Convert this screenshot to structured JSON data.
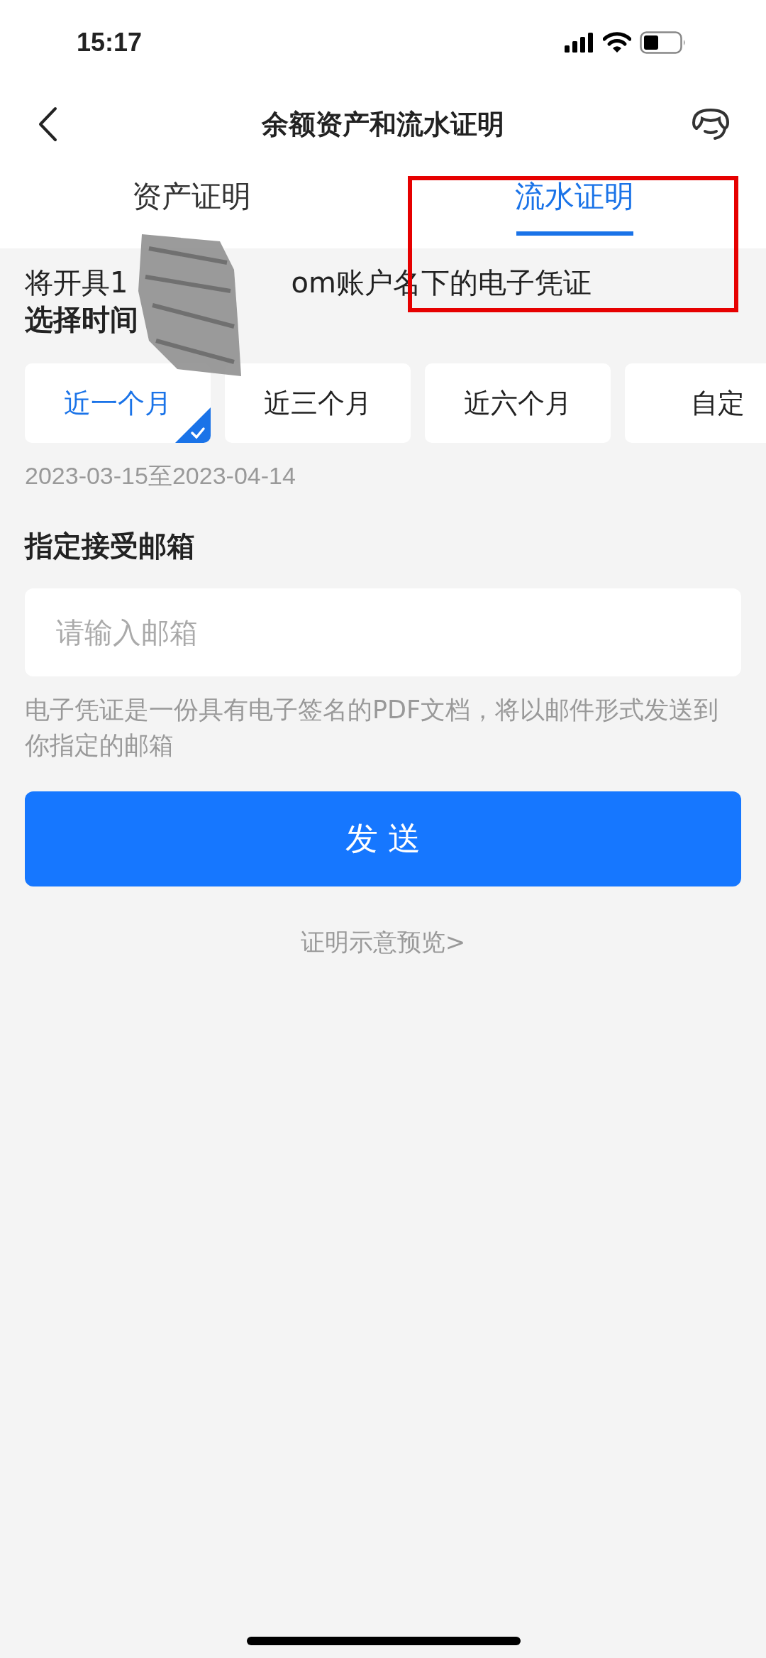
{
  "status_bar": {
    "time": "15:17"
  },
  "nav": {
    "title": "余额资产和流水证明"
  },
  "tabs": [
    {
      "label": "资产证明",
      "selected": false
    },
    {
      "label": "流水证明",
      "selected": true
    }
  ],
  "notice": {
    "text_start": "将开具1",
    "text_end": "om账户名下的电子凭证",
    "time_label": "选择时间"
  },
  "periods": [
    {
      "label": "近一个月",
      "selected": true
    },
    {
      "label": "近三个月",
      "selected": false
    },
    {
      "label": "近六个月",
      "selected": false
    },
    {
      "label": "自定",
      "selected": false
    }
  ],
  "date_range": "2023-03-15至2023-04-14",
  "email": {
    "label": "指定接受邮箱",
    "placeholder": "请输入邮箱",
    "hint": "电子凭证是一份具有电子签名的PDF文档，将以邮件形式发送到你指定的邮箱"
  },
  "send_button": "发 送",
  "preview_link": "证明示意预览>"
}
